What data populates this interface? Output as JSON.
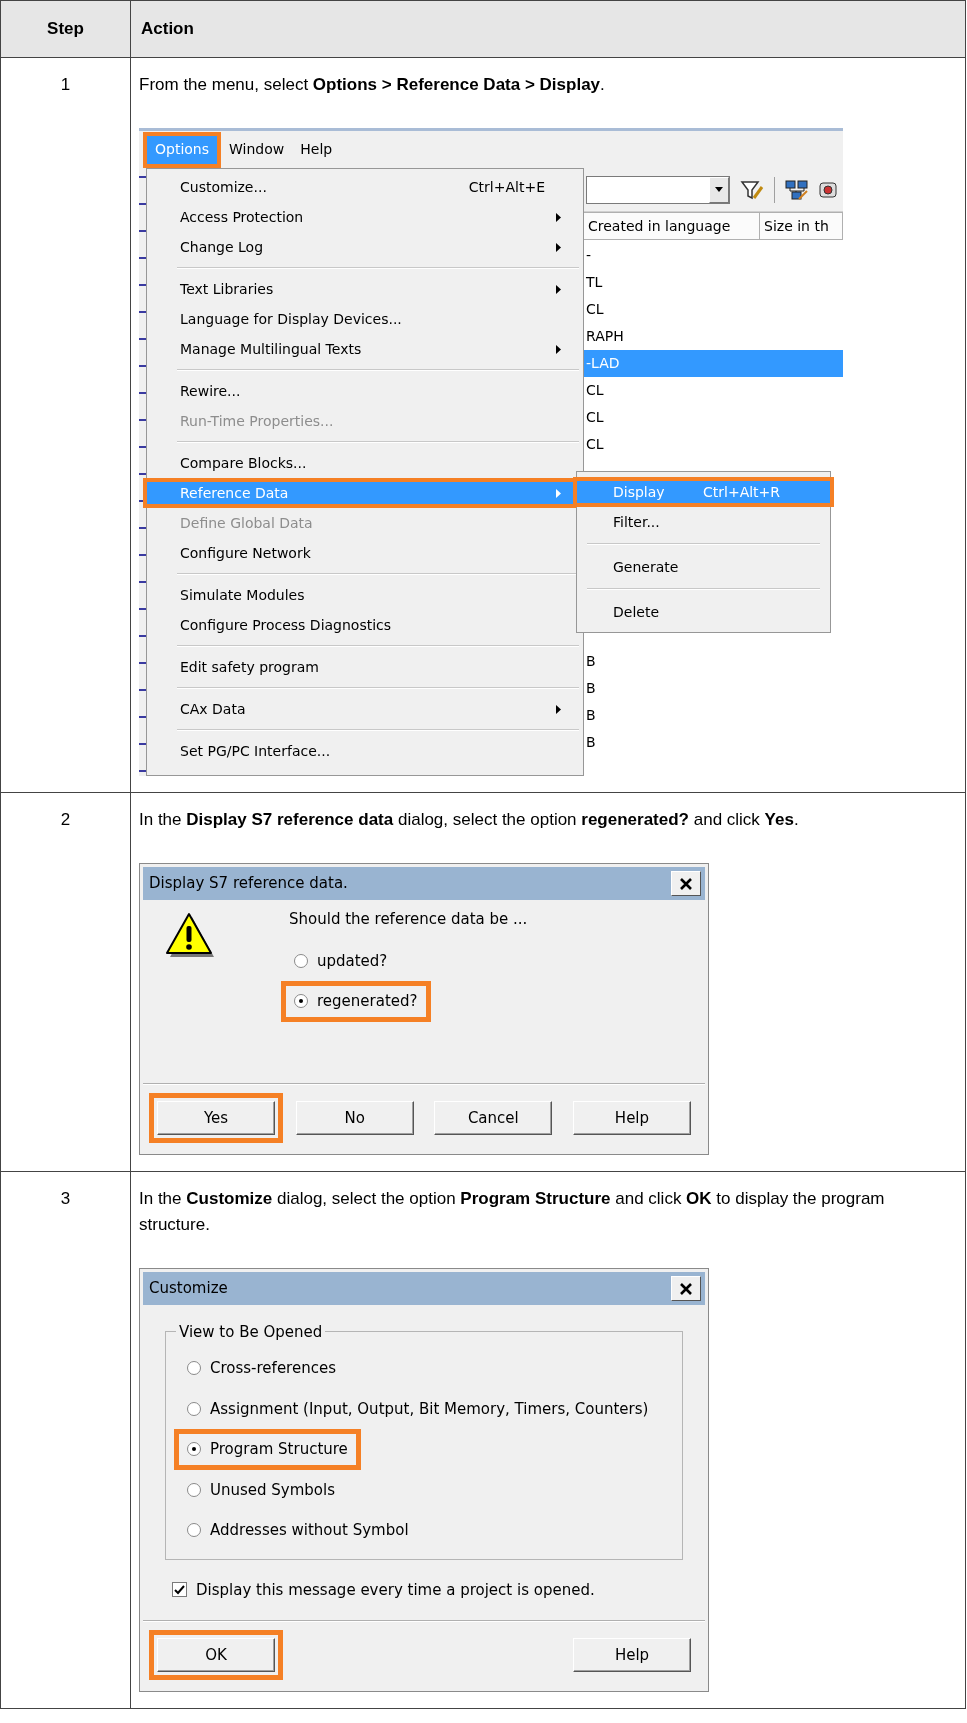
{
  "table": {
    "columns": [
      "Step",
      "Action"
    ],
    "rows": [
      {
        "step": "1",
        "instruction": "From the menu, select **Options > Reference Data > Display**.",
        "screenshot": {
          "kind": "menu_screen",
          "menu_bar": [
            {
              "label": "Options",
              "selected": true,
              "callout": true
            },
            {
              "label": "Window",
              "selected": false,
              "callout": false
            },
            {
              "label": "Help",
              "selected": false,
              "callout": false
            }
          ],
          "menu_items": [
            {
              "kind": "item",
              "label": "Customize...",
              "shortcut": "Ctrl+Alt+E",
              "has_submenu": false,
              "disabled": false,
              "selected": false,
              "callout": false
            },
            {
              "kind": "item",
              "label": "Access Protection",
              "has_submenu": true,
              "disabled": false,
              "selected": false,
              "callout": false
            },
            {
              "kind": "item",
              "label": "Change Log",
              "has_submenu": true,
              "disabled": false,
              "selected": false,
              "callout": false
            },
            {
              "kind": "separator"
            },
            {
              "kind": "item",
              "label": "Text Libraries",
              "has_submenu": true,
              "disabled": false,
              "selected": false,
              "callout": false
            },
            {
              "kind": "item",
              "label": "Language for Display Devices...",
              "has_submenu": false,
              "disabled": false,
              "selected": false,
              "callout": false
            },
            {
              "kind": "item",
              "label": "Manage Multilingual Texts",
              "has_submenu": true,
              "disabled": false,
              "selected": false,
              "callout": false
            },
            {
              "kind": "separator"
            },
            {
              "kind": "item",
              "label": "Rewire...",
              "has_submenu": false,
              "disabled": false,
              "selected": false,
              "callout": false
            },
            {
              "kind": "item",
              "label": "Run-Time Properties...",
              "has_submenu": false,
              "disabled": true,
              "selected": false,
              "callout": false
            },
            {
              "kind": "separator"
            },
            {
              "kind": "item",
              "label": "Compare Blocks...",
              "has_submenu": false,
              "disabled": false,
              "selected": false,
              "callout": false
            },
            {
              "kind": "item",
              "label": "Reference Data",
              "has_submenu": true,
              "disabled": false,
              "selected": true,
              "callout": true
            },
            {
              "kind": "item",
              "label": "Define Global Data",
              "has_submenu": false,
              "disabled": true,
              "selected": false,
              "callout": false
            },
            {
              "kind": "item",
              "label": "Configure Network",
              "has_submenu": false,
              "disabled": false,
              "selected": false,
              "callout": false
            },
            {
              "kind": "separator"
            },
            {
              "kind": "item",
              "label": "Simulate Modules",
              "has_submenu": false,
              "disabled": false,
              "selected": false,
              "callout": false
            },
            {
              "kind": "item",
              "label": "Configure Process Diagnostics",
              "has_submenu": false,
              "disabled": false,
              "selected": false,
              "callout": false
            },
            {
              "kind": "separator"
            },
            {
              "kind": "item",
              "label": "Edit safety program",
              "has_submenu": false,
              "disabled": false,
              "selected": false,
              "callout": false
            },
            {
              "kind": "separator"
            },
            {
              "kind": "item",
              "label": "CAx Data",
              "has_submenu": true,
              "disabled": false,
              "selected": false,
              "callout": false
            },
            {
              "kind": "separator"
            },
            {
              "kind": "item",
              "label": "Set PG/PC Interface...",
              "has_submenu": false,
              "disabled": false,
              "selected": false,
              "callout": false
            }
          ],
          "submenu_items": [
            {
              "kind": "item",
              "label": "Display",
              "shortcut": "Ctrl+Alt+R",
              "selected": true,
              "callout": true
            },
            {
              "kind": "item",
              "label": "Filter...",
              "selected": false,
              "callout": false
            },
            {
              "kind": "separator"
            },
            {
              "kind": "item",
              "label": "Generate",
              "selected": false,
              "callout": false
            },
            {
              "kind": "separator"
            },
            {
              "kind": "item",
              "label": "Delete",
              "selected": false,
              "callout": false
            }
          ],
          "list_columns": [
            "Created in language",
            "Size in th"
          ],
          "rows_top": [
            {
              "text": "-",
              "selected": false
            },
            {
              "text": "TL",
              "selected": false
            },
            {
              "text": "CL",
              "selected": false
            },
            {
              "text": "RAPH",
              "selected": false
            },
            {
              "text": "-LAD",
              "selected": true
            },
            {
              "text": "CL",
              "selected": false
            },
            {
              "text": "CL",
              "selected": false
            },
            {
              "text": "CL",
              "selected": false
            }
          ],
          "rows_bottom": [
            {
              "text": "B",
              "selected": false
            },
            {
              "text": "B",
              "selected": false
            },
            {
              "text": "B",
              "selected": false
            },
            {
              "text": "B",
              "selected": false
            }
          ]
        }
      },
      {
        "step": "2",
        "instruction": "In the **Display S7 reference data** dialog, select the option **regenerated?** and click **Yes**.",
        "screenshot": {
          "kind": "dialog",
          "title": "Display S7 reference data.",
          "message": "Should the reference data be ...",
          "options": [
            {
              "label": "updated?",
              "selected": false,
              "callout": false
            },
            {
              "label": "regenerated?",
              "selected": true,
              "callout": true
            }
          ],
          "buttons": [
            {
              "label": "Yes",
              "callout": true
            },
            {
              "label": "No",
              "callout": false
            },
            {
              "label": "Cancel",
              "callout": false
            },
            {
              "label": "Help",
              "callout": false
            }
          ]
        }
      },
      {
        "step": "3",
        "instruction": "In the **Customize** dialog, select the option **Program Structure** and click **OK** to display the program structure.",
        "screenshot": {
          "kind": "dialog",
          "title": "Customize",
          "group": {
            "title": "View to Be Opened",
            "options": [
              {
                "label": "Cross-references",
                "selected": false,
                "callout": false
              },
              {
                "label": "Assignment (Input, Output, Bit Memory, Timers, Counters)",
                "selected": false,
                "callout": false
              },
              {
                "label": "Program Structure",
                "selected": true,
                "callout": true
              },
              {
                "label": "Unused Symbols",
                "selected": false,
                "callout": false
              },
              {
                "label": "Addresses without Symbol",
                "selected": false,
                "callout": false
              }
            ]
          },
          "checkbox": {
            "label": "Display this message every time a project is opened.",
            "checked": true
          },
          "buttons": [
            {
              "label": "OK",
              "callout": true
            },
            {
              "label": "Help",
              "callout": false
            }
          ]
        }
      }
    ]
  }
}
